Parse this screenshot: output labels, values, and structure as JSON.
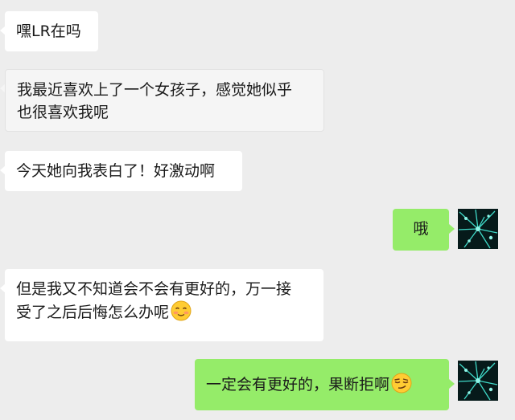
{
  "messages": [
    {
      "side": "incoming",
      "text": "嘿LR在吗"
    },
    {
      "side": "incoming",
      "lines": [
        "我最近喜欢上了一个女孩子，感觉她似乎",
        "也很喜欢我呢"
      ]
    },
    {
      "side": "incoming",
      "text": "今天她向我表白了！好激动啊"
    },
    {
      "side": "outgoing",
      "text": "哦"
    },
    {
      "side": "incoming",
      "lines": [
        "但是我又不知道会不会有更好的，万一接",
        "受了之后后悔怎么办呢"
      ],
      "emoji": "smiling-blush-face"
    },
    {
      "side": "outgoing",
      "text": "一定会有更好的，果断拒啊",
      "emoji": "smirking-face"
    }
  ],
  "colors": {
    "background": "#ededed",
    "incoming_bubble": "#ffffff",
    "outgoing_bubble": "#95ec69",
    "avatar_bg": "#061a1a",
    "avatar_accent": "#3fd9c8"
  }
}
